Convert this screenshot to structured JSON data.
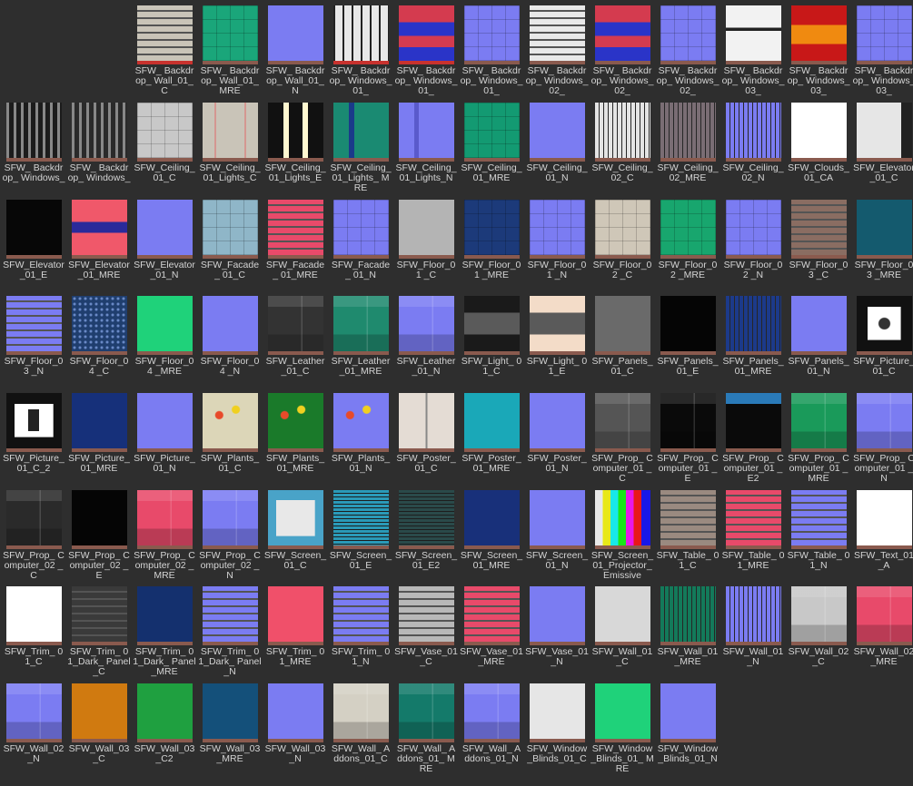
{
  "assets": [
    {
      "label": "SFW_ Backdrop_ Wall_01_C",
      "fill": "#c9c4b8",
      "style": "stripes-h",
      "selected": true
    },
    {
      "label": "SFW_ Backdrop_ Wall_01_MRE",
      "fill": "#1aa67a",
      "style": "grid"
    },
    {
      "label": "SFW_ Backdrop_ Wall_01_N",
      "fill": "#7b7cf2",
      "style": "flat"
    },
    {
      "label": "SFW_ Backdrop_ Windows_01_",
      "fill": "#e8e8e8",
      "style": "windows",
      "selected": true
    },
    {
      "label": "SFW_ Backdrop_ Windows_01_",
      "fill": "#d43b4f",
      "style": "redblue",
      "selected": true
    },
    {
      "label": "SFW_ Backdrop_ Windows_01_",
      "fill": "#7b7cf2",
      "style": "grid"
    },
    {
      "label": "SFW_ Backdrop_ Windows_02_",
      "fill": "#e8e8e8",
      "style": "stripes-h"
    },
    {
      "label": "SFW_ Backdrop_ Windows_02_",
      "fill": "#d43b4f",
      "style": "redblue"
    },
    {
      "label": "SFW_ Backdrop_ Windows_02_",
      "fill": "#7b7cf2",
      "style": "grid"
    },
    {
      "label": "SFW_ Backdrop_ Windows_03_",
      "fill": "#f2f2f2",
      "style": "window3"
    },
    {
      "label": "SFW_ Backdrop_ Windows_03_",
      "fill": "#d02020",
      "style": "fire"
    },
    {
      "label": "SFW_ Backdrop_ Windows_03_",
      "fill": "#7b7cf2",
      "style": "grid"
    },
    {
      "label": "SFW_ Backdrop_ Windows_",
      "fill": "#1c1c1c",
      "style": "city"
    },
    {
      "label": "SFW_ Backdrop_ Windows_",
      "fill": "#2a2a2a",
      "style": "city"
    },
    {
      "label": "SFW_Ceiling_ 01_C",
      "fill": "#c8c8c8",
      "style": "grid"
    },
    {
      "label": "SFW_Ceiling_ 01_Lights_C",
      "fill": "#c9c4b8",
      "style": "lightbar"
    },
    {
      "label": "SFW_Ceiling_ 01_Lights_E",
      "fill": "#111111",
      "style": "lightbar-e"
    },
    {
      "label": "SFW_Ceiling_ 01_Lights_ MRE",
      "fill": "#1a8a72",
      "style": "lightbar-mre"
    },
    {
      "label": "SFW_Ceiling_ 01_Lights_N",
      "fill": "#7b7cf2",
      "style": "lightbar-n"
    },
    {
      "label": "SFW_Ceiling_ 01_MRE",
      "fill": "#139a72",
      "style": "grid"
    },
    {
      "label": "SFW_Ceiling_ 01_N",
      "fill": "#7b7cf2",
      "style": "flat"
    },
    {
      "label": "SFW_Ceiling_ 02_C",
      "fill": "#e4e4e4",
      "style": "stripes-v"
    },
    {
      "label": "SFW_Ceiling_ 02_MRE",
      "fill": "#7a6d74",
      "style": "stripes-v"
    },
    {
      "label": "SFW_Ceiling_ 02_N",
      "fill": "#7b7cf2",
      "style": "stripes-v"
    },
    {
      "label": "SFW_Clouds_ 01_CA",
      "fill": "#ffffff",
      "style": "flat"
    },
    {
      "label": "SFW_Elevator _01_C",
      "fill": "#e6e6e6",
      "style": "elevator"
    },
    {
      "label": "SFW_Elevator _01_E",
      "fill": "#070707",
      "style": "flat"
    },
    {
      "label": "SFW_Elevator _01_MRE",
      "fill": "#f0586a",
      "style": "elev-mre"
    },
    {
      "label": "SFW_Elevator _01_N",
      "fill": "#7b7cf2",
      "style": "flat"
    },
    {
      "label": "SFW_Facade_ 01_C",
      "fill": "#8fb6c8",
      "style": "grid"
    },
    {
      "label": "SFW_Facade_ 01_MRE",
      "fill": "#e84a6a",
      "style": "stripes-h"
    },
    {
      "label": "SFW_Facade_ 01_N",
      "fill": "#7b7cf2",
      "style": "grid"
    },
    {
      "label": "SFW_Floor_01 _C",
      "fill": "#b4b4b4",
      "style": "flat"
    },
    {
      "label": "SFW_Floor_01 _MRE",
      "fill": "#1c3a7a",
      "style": "grid"
    },
    {
      "label": "SFW_Floor_01 _N",
      "fill": "#7b7cf2",
      "style": "grid"
    },
    {
      "label": "SFW_Floor_02 _C",
      "fill": "#cfc7b8",
      "style": "grid"
    },
    {
      "label": "SFW_Floor_02 _MRE",
      "fill": "#18a66e",
      "style": "grid"
    },
    {
      "label": "SFW_Floor_02 _N",
      "fill": "#7b7cf2",
      "style": "grid"
    },
    {
      "label": "SFW_Floor_03 _C",
      "fill": "#8a6d62",
      "style": "stripes-h"
    },
    {
      "label": "SFW_Floor_03 _MRE",
      "fill": "#145a6e",
      "style": "flat"
    },
    {
      "label": "SFW_Floor_03 _N",
      "fill": "#7b7cf2",
      "style": "stripes-h"
    },
    {
      "label": "SFW_Floor_04 _C",
      "fill": "#1f3e6e",
      "style": "pattern"
    },
    {
      "label": "SFW_Floor_04 _MRE",
      "fill": "#1fd27a",
      "style": "flat"
    },
    {
      "label": "SFW_Floor_04 _N",
      "fill": "#7b7cf2",
      "style": "flat"
    },
    {
      "label": "SFW_Leather _01_C",
      "fill": "#333333",
      "style": "atlas"
    },
    {
      "label": "SFW_Leather _01_MRE",
      "fill": "#1f8a6e",
      "style": "atlas"
    },
    {
      "label": "SFW_Leather _01_N",
      "fill": "#7b7cf2",
      "style": "atlas"
    },
    {
      "label": "SFW_Light_ 01_C",
      "fill": "#1a1a1a",
      "style": "light"
    },
    {
      "label": "SFW_Light_ 01_E",
      "fill": "#f3dcc8",
      "style": "light"
    },
    {
      "label": "SFW_Panels_ 01_C",
      "fill": "#6a6a6a",
      "style": "flat"
    },
    {
      "label": "SFW_Panels_ 01_E",
      "fill": "#050505",
      "style": "flat"
    },
    {
      "label": "SFW_Panels_ 01_MRE",
      "fill": "#1c3a8a",
      "style": "stripes-v"
    },
    {
      "label": "SFW_Panels_ 01_N",
      "fill": "#7b7cf2",
      "style": "flat"
    },
    {
      "label": "SFW_Picture_ 01_C",
      "fill": "#d8d8d8",
      "style": "picture"
    },
    {
      "label": "SFW_Picture_ 01_C_2",
      "fill": "#ffffff",
      "style": "picture2"
    },
    {
      "label": "SFW_Picture_ 01_MRE",
      "fill": "#16307a",
      "style": "flat"
    },
    {
      "label": "SFW_Picture_ 01_N",
      "fill": "#7b7cf2",
      "style": "flat"
    },
    {
      "label": "SFW_Plants_ 01_C",
      "fill": "#dcd6b8",
      "style": "plants"
    },
    {
      "label": "SFW_Plants_ 01_MRE",
      "fill": "#1a7a2a",
      "style": "plants"
    },
    {
      "label": "SFW_Plants_ 01_N",
      "fill": "#7b7cf2",
      "style": "plants"
    },
    {
      "label": "SFW_Poster_ 01_C",
      "fill": "#e4dcd4",
      "style": "poster"
    },
    {
      "label": "SFW_Poster_ 01_MRE",
      "fill": "#1aa8b8",
      "style": "flat"
    },
    {
      "label": "SFW_Poster_ 01_N",
      "fill": "#7b7cf2",
      "style": "flat"
    },
    {
      "label": "SFW_Prop_ Computer_01 _C",
      "fill": "#555555",
      "style": "atlas"
    },
    {
      "label": "SFW_Prop_ Computer_01 _E",
      "fill": "#0a0a0a",
      "style": "atlas"
    },
    {
      "label": "SFW_Prop_ Computer_01 _E2",
      "fill": "#0a0a0a",
      "style": "comp-e2"
    },
    {
      "label": "SFW_Prop_ Computer_01 _MRE",
      "fill": "#1a9a5a",
      "style": "atlas"
    },
    {
      "label": "SFW_Prop_ Computer_01 _N",
      "fill": "#7b7cf2",
      "style": "atlas"
    },
    {
      "label": "SFW_Prop_ Computer_02 _C",
      "fill": "#2a2a2a",
      "style": "atlas"
    },
    {
      "label": "SFW_Prop_ Computer_02 _E",
      "fill": "#050505",
      "style": "flat"
    },
    {
      "label": "SFW_Prop_ Computer_02 _MRE",
      "fill": "#e84a6a",
      "style": "atlas"
    },
    {
      "label": "SFW_Prop_ Computer_02 _N",
      "fill": "#7b7cf2",
      "style": "atlas"
    },
    {
      "label": "SFW_Screen_ 01_C",
      "fill": "#49a3c8",
      "style": "screen"
    },
    {
      "label": "SFW_Screen_ 01_E",
      "fill": "#2a9ab8",
      "style": "scanlines"
    },
    {
      "label": "SFW_Screen_ 01_E2",
      "fill": "#2a4a4a",
      "style": "scanlines"
    },
    {
      "label": "SFW_Screen_ 01_MRE",
      "fill": "#18307a",
      "style": "flat"
    },
    {
      "label": "SFW_Screen_ 01_N",
      "fill": "#7b7cf2",
      "style": "flat"
    },
    {
      "label": "SFW_Screen_ 01_Projector_ Emissive",
      "fill": "#ffffff",
      "style": "tvbars"
    },
    {
      "label": "SFW_Table_ 01_C",
      "fill": "#9a8a80",
      "style": "stripes-h"
    },
    {
      "label": "SFW_Table_ 01_MRE",
      "fill": "#e84a6a",
      "style": "stripes-h"
    },
    {
      "label": "SFW_Table_ 01_N",
      "fill": "#7b7cf2",
      "style": "stripes-h"
    },
    {
      "label": "SFW_Text_01 _A",
      "fill": "#ffffff",
      "style": "flat"
    },
    {
      "label": "SFW_Trim_ 01_C",
      "fill": "#ffffff",
      "style": "flat"
    },
    {
      "label": "SFW_Trim_ 01_Dark_ Panel_C",
      "fill": "#3a3a3a",
      "style": "stripes-h"
    },
    {
      "label": "SFW_Trim_ 01_Dark_ Panel_MRE",
      "fill": "#14306e",
      "style": "flat"
    },
    {
      "label": "SFW_Trim_ 01_Dark_ Panel_N",
      "fill": "#7b7cf2",
      "style": "stripes-h"
    },
    {
      "label": "SFW_Trim_ 01_MRE",
      "fill": "#f0506a",
      "style": "flat"
    },
    {
      "label": "SFW_Trim_ 01_N",
      "fill": "#7b7cf2",
      "style": "stripes-h"
    },
    {
      "label": "SFW_Vase_01 _C",
      "fill": "#b8b8b8",
      "style": "stripes-h"
    },
    {
      "label": "SFW_Vase_01 _MRE",
      "fill": "#e84a6a",
      "style": "stripes-h"
    },
    {
      "label": "SFW_Vase_01 _N",
      "fill": "#7b7cf2",
      "style": "flat"
    },
    {
      "label": "SFW_Wall_01 _C",
      "fill": "#d8d8d8",
      "style": "flat"
    },
    {
      "label": "SFW_Wall_01 _MRE",
      "fill": "#137a5a",
      "style": "stripes-v"
    },
    {
      "label": "SFW_Wall_01 _N",
      "fill": "#7b7cf2",
      "style": "stripes-v"
    },
    {
      "label": "SFW_Wall_02 _C",
      "fill": "#c8c8c8",
      "style": "atlas"
    },
    {
      "label": "SFW_Wall_02 _MRE",
      "fill": "#e84a6a",
      "style": "atlas"
    },
    {
      "label": "SFW_Wall_02 _N",
      "fill": "#7b7cf2",
      "style": "atlas"
    },
    {
      "label": "SFW_Wall_03 _C",
      "fill": "#d07a10",
      "style": "flat"
    },
    {
      "label": "SFW_Wall_03 _C2",
      "fill": "#1fa040",
      "style": "flat"
    },
    {
      "label": "SFW_Wall_03 _MRE",
      "fill": "#14507a",
      "style": "flat"
    },
    {
      "label": "SFW_Wall_03 _N",
      "fill": "#7b7cf2",
      "style": "flat"
    },
    {
      "label": "SFW_Wall_ Addons_01_C",
      "fill": "#d4d0c4",
      "style": "atlas"
    },
    {
      "label": "SFW_Wall_ Addons_01_ MRE",
      "fill": "#147a6a",
      "style": "atlas"
    },
    {
      "label": "SFW_Wall_ Addons_01_N",
      "fill": "#7b7cf2",
      "style": "atlas"
    },
    {
      "label": "SFW_Window _Blinds_01_C",
      "fill": "#e6e6e6",
      "style": "flat"
    },
    {
      "label": "SFW_Window _Blinds_01_ MRE",
      "fill": "#1fd27a",
      "style": "flat"
    },
    {
      "label": "SFW_Window _Blinds_01_N",
      "fill": "#7b7cf2",
      "style": "flat"
    }
  ]
}
